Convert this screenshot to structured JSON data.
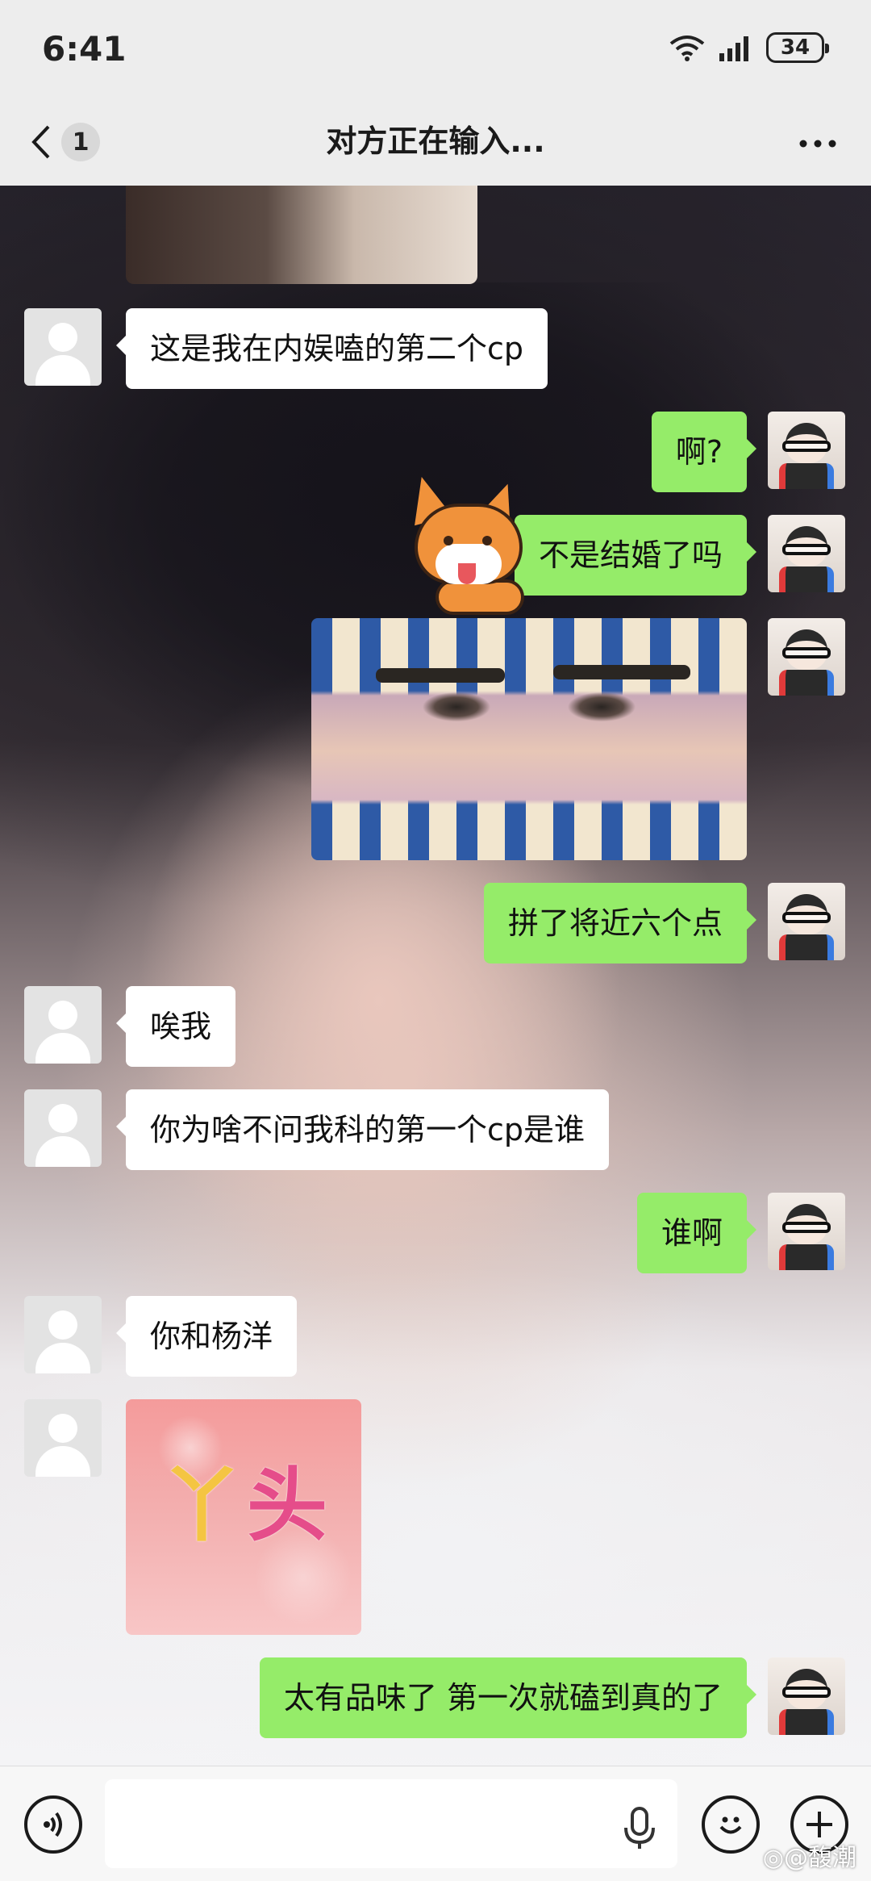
{
  "status_bar": {
    "time": "6:41",
    "battery": "34"
  },
  "nav": {
    "badge": "1",
    "title": "对方正在输入..."
  },
  "messages": [
    {
      "side": "in",
      "text": "这是我在内娱嗑的第二个cp"
    },
    {
      "side": "out",
      "text": "啊?"
    },
    {
      "side": "out",
      "text": "不是结婚了吗"
    },
    {
      "side": "out",
      "text": "拼了将近六个点"
    },
    {
      "side": "in",
      "text": "唉我"
    },
    {
      "side": "in",
      "text": "你为啥不问我科的第一个cp是谁"
    },
    {
      "side": "out",
      "text": "谁啊"
    },
    {
      "side": "in",
      "text": "你和杨洋"
    },
    {
      "side": "out",
      "text": "太有品味了 第一次就磕到真的了"
    }
  ],
  "images": {
    "yatou_text_1": "丫",
    "yatou_text_2": "头"
  },
  "input": {
    "placeholder": ""
  },
  "watermark": "◎@馥潮"
}
